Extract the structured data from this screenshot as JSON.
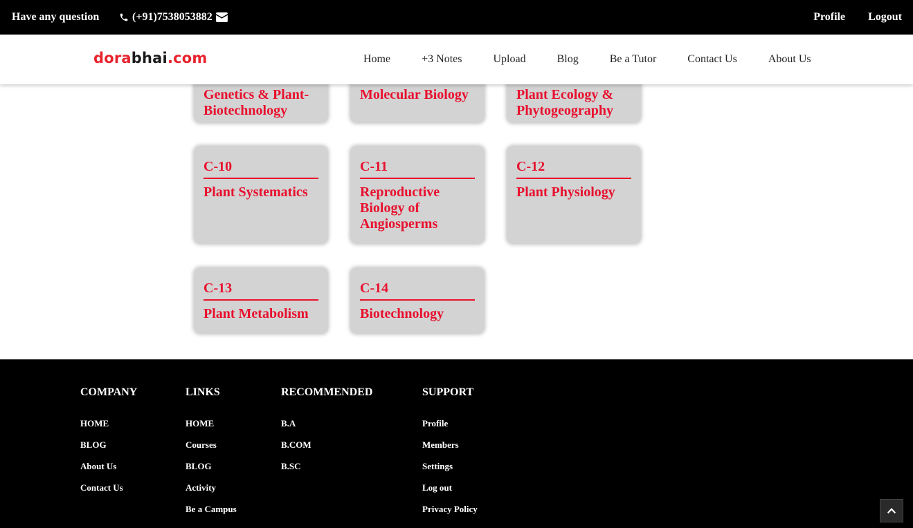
{
  "topbar": {
    "question": "Have any question",
    "phone": "(+91)7538053882",
    "profile": "Profile",
    "logout": "Logout"
  },
  "logo": {
    "part1": "dora",
    "part2": "bhai",
    "part3": ".com"
  },
  "nav": {
    "items": [
      "Home",
      "+3 Notes",
      "Upload",
      "Blog",
      "Be a Tutor",
      "Contact Us",
      "About Us"
    ]
  },
  "cards": [
    {
      "code": "",
      "title": "Genetics & Plant-Biotechnology"
    },
    {
      "code": "",
      "title": "Molecular Biology"
    },
    {
      "code": "",
      "title": "Plant Ecology & Phytogeography"
    },
    {
      "code": "C-10",
      "title": "Plant Systematics"
    },
    {
      "code": "C-11",
      "title": "Reproductive Biology of Angiosperms"
    },
    {
      "code": "C-12",
      "title": "Plant Physiology"
    },
    {
      "code": "C-13",
      "title": "Plant Metabolism"
    },
    {
      "code": "C-14",
      "title": "Biotechnology"
    }
  ],
  "footer": {
    "company": {
      "heading": "COMPANY",
      "items": [
        "HOME",
        "BLOG",
        "About Us",
        "Contact Us"
      ]
    },
    "links": {
      "heading": "LINKS",
      "items": [
        "HOME",
        "Courses",
        "BLOG",
        "Activity",
        "Be a Campus"
      ]
    },
    "recommended": {
      "heading": "RECOMMENDED",
      "items": [
        "B.A",
        "B.COM",
        "B.SC"
      ]
    },
    "support": {
      "heading": "SUPPORT",
      "items": [
        "Profile",
        "Members",
        "Settings",
        "Log out",
        "Privacy Policy"
      ]
    }
  },
  "icons": {
    "phone": "phone-icon",
    "mail": "envelope-icon",
    "scroll_top": "chevron-up-icon"
  },
  "colors": {
    "accent": "#e8102e",
    "card_bg": "#d3d3d3",
    "bar_bg": "#000000"
  }
}
